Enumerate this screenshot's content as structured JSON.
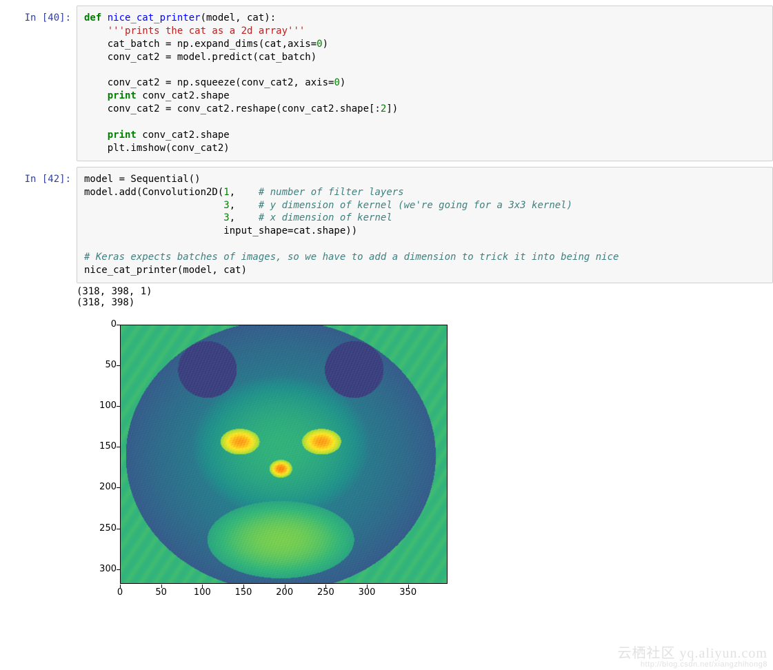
{
  "cells": {
    "cell40": {
      "prompt": "In [40]:",
      "code_lines": [
        [
          {
            "t": "def ",
            "c": "kw"
          },
          {
            "t": "nice_cat_printer",
            "c": "nf"
          },
          {
            "t": "(model, cat):",
            "c": ""
          }
        ],
        [
          {
            "t": "    ",
            "c": ""
          },
          {
            "t": "'''prints the cat as a 2d array'''",
            "c": "docs"
          }
        ],
        [
          {
            "t": "    cat_batch = np.expand_dims(cat,axis=",
            "c": ""
          },
          {
            "t": "0",
            "c": "num"
          },
          {
            "t": ")",
            "c": ""
          }
        ],
        [
          {
            "t": "    conv_cat2 = model.predict(cat_batch)",
            "c": ""
          }
        ],
        [
          {
            "t": "",
            "c": ""
          }
        ],
        [
          {
            "t": "    conv_cat2 = np.squeeze(conv_cat2, axis=",
            "c": ""
          },
          {
            "t": "0",
            "c": "num"
          },
          {
            "t": ")",
            "c": ""
          }
        ],
        [
          {
            "t": "    ",
            "c": ""
          },
          {
            "t": "print",
            "c": "kw"
          },
          {
            "t": " conv_cat2.shape",
            "c": ""
          }
        ],
        [
          {
            "t": "    conv_cat2 = conv_cat2.reshape(conv_cat2.shape[:",
            "c": ""
          },
          {
            "t": "2",
            "c": "num"
          },
          {
            "t": "])",
            "c": ""
          }
        ],
        [
          {
            "t": "",
            "c": ""
          }
        ],
        [
          {
            "t": "    ",
            "c": ""
          },
          {
            "t": "print",
            "c": "kw"
          },
          {
            "t": " conv_cat2.shape",
            "c": ""
          }
        ],
        [
          {
            "t": "    plt.imshow(conv_cat2)",
            "c": ""
          }
        ]
      ]
    },
    "cell42": {
      "prompt": "In [42]:",
      "code_lines": [
        [
          {
            "t": "model = Sequential()",
            "c": ""
          }
        ],
        [
          {
            "t": "model.add(Convolution2D(",
            "c": ""
          },
          {
            "t": "1",
            "c": "num"
          },
          {
            "t": ",    ",
            "c": ""
          },
          {
            "t": "# number of filter layers",
            "c": "cmt"
          }
        ],
        [
          {
            "t": "                        ",
            "c": ""
          },
          {
            "t": "3",
            "c": "num"
          },
          {
            "t": ",    ",
            "c": ""
          },
          {
            "t": "# y dimension of kernel (we're going for a 3x3 kernel)",
            "c": "cmt"
          }
        ],
        [
          {
            "t": "                        ",
            "c": ""
          },
          {
            "t": "3",
            "c": "num"
          },
          {
            "t": ",    ",
            "c": ""
          },
          {
            "t": "# x dimension of kernel",
            "c": "cmt"
          }
        ],
        [
          {
            "t": "                        input_shape=cat.shape))",
            "c": ""
          }
        ],
        [
          {
            "t": "",
            "c": ""
          }
        ],
        [
          {
            "t": "# Keras expects batches of images, so we have to add a dimension to trick it into being nice",
            "c": "cmt"
          }
        ],
        [
          {
            "t": "nice_cat_printer(model, cat)",
            "c": ""
          }
        ]
      ],
      "output_text": "(318, 398, 1)\n(318, 398)"
    }
  },
  "chart_data": {
    "type": "heatmap",
    "title": "",
    "xlabel": "",
    "ylabel": "",
    "x_range": [
      0,
      398
    ],
    "y_range": [
      0,
      318
    ],
    "y_inverted": true,
    "xticks": [
      0,
      50,
      100,
      150,
      200,
      250,
      300,
      350
    ],
    "yticks": [
      0,
      50,
      100,
      150,
      200,
      250,
      300
    ],
    "colormap": "viridis",
    "description": "2D convolution output of a cat image displayed with matplotlib imshow; background region renders uniform green (~0), cat body renders blue→cyan→yellow (lower values), eyes/nose/mouth highlights render orange-red (highest values)."
  },
  "watermark": {
    "line1": "云栖社区 yq.aliyun.com",
    "line2": "http://blog.csdn.net/xiangzhihong8"
  }
}
